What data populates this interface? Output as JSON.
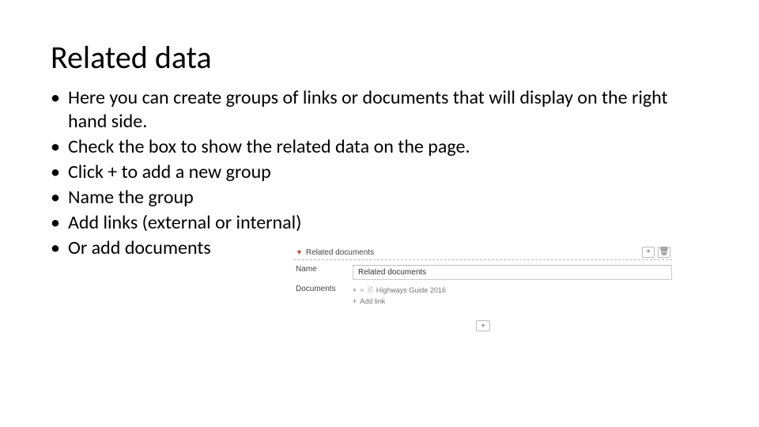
{
  "title": "Related data",
  "bullets": [
    "Here you can create groups of links or documents that will display on the right hand side.",
    "Check the box to show the related data on the page.",
    "Click + to add a new group",
    "Name the group",
    "Add links  (external or internal)",
    "Or add documents"
  ],
  "panel": {
    "header_label": "Related documents",
    "add_glyph": "+",
    "delete_glyph": "🗑",
    "name_label": "Name",
    "name_value": "Related documents",
    "documents_label": "Documents",
    "doc_item_plus": "+",
    "doc_item_x": "×",
    "doc_item_page": "🗎",
    "doc_item_text": "Highways Guide 2016",
    "add_link_plus": "+",
    "add_link_text": "Add link",
    "bottom_add_glyph": "+"
  }
}
